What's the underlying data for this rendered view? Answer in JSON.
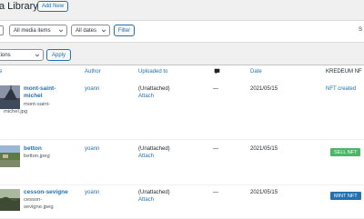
{
  "header": {
    "title": "a Library",
    "add_new": "Add New"
  },
  "filters": {
    "media_type": "All media items",
    "dates": "All dates",
    "filter_button": "Filter",
    "search_partial": "S"
  },
  "bulk": {
    "action": "tions",
    "apply": "Apply"
  },
  "columns": {
    "file": "e",
    "author": "Author",
    "uploaded_to": "Uploaded to",
    "date": "Date",
    "kredeum": "KREDEUM NF"
  },
  "rows": [
    {
      "title_line1": "mont-saint-",
      "title_line2": "michel",
      "file_line1": "mont-saint-",
      "file_line2": "michel.jpg",
      "author": "yoann",
      "uploaded": "(Unattached)",
      "attach": "Attach",
      "comments": "—",
      "date": "2021/05/15",
      "nft_text": "NFT created"
    },
    {
      "title_line1": "betton",
      "file_line1": "betton.jpeg",
      "author": "yoann",
      "uploaded": "(Unattached)",
      "attach": "Attach",
      "comments": "—",
      "date": "2021/05/15",
      "nft_badge": "SELL NFT",
      "nft_badge_color": "#4ab866"
    },
    {
      "title_line1": "cesson-sevigne",
      "file_line1": "cesson-",
      "file_line2": "sevigne.jpeg",
      "author": "yoann",
      "uploaded": "(Unattached)",
      "attach": "Attach",
      "comments": "—",
      "date": "2021/05/15",
      "nft_badge": "MINT NFT",
      "nft_badge_color": "#2271b1"
    }
  ],
  "colors": {
    "accent": "#2271b1",
    "background": "#f0f0f1"
  },
  "icons": {
    "comments": "comment-bubble-icon",
    "chevron": "chevron-down-icon"
  }
}
